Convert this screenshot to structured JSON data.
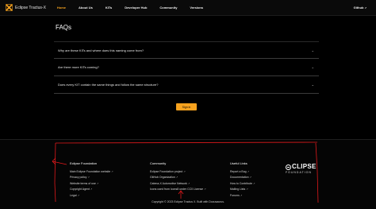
{
  "navbar": {
    "brand": "Eclipse Tractus-X",
    "links": [
      "Home",
      "About Us",
      "KITs",
      "Developer Hub",
      "Community",
      "Versions"
    ],
    "github": "Github"
  },
  "main": {
    "title": "FAQs",
    "faqs": [
      "Why are these KITs and where does this naming come from?",
      "Are there more KITs coming?",
      "Does every KIT contain the same things and follow the same structure?"
    ],
    "signin": "Sign in"
  },
  "footer": {
    "columns": [
      {
        "title": "Eclipse Foundation",
        "links": [
          "Main Eclipse Foundation website",
          "Privacy policy",
          "Website terms of use",
          "Copyright Agent",
          "Legal"
        ]
      },
      {
        "title": "Community",
        "links": [
          "Eclipse Foundation project",
          "GitHub Organization",
          "Catena-X Automotive Network",
          "Icons used from Icons8 under CC0 License"
        ]
      },
      {
        "title": "Useful Links",
        "links": [
          "Report a Bug",
          "Documentation",
          "How to Contribute",
          "Mailing Lists",
          "Forums"
        ]
      }
    ],
    "logo_word": "CLIPSE",
    "logo_sub": "FOUNDATION",
    "copyright": "Copyright © 2023 Eclipse Tractus X. Built with Docusaurus."
  },
  "colors": {
    "accent": "#f6a21e",
    "annotation": "#e0191b",
    "background": "#000000"
  }
}
